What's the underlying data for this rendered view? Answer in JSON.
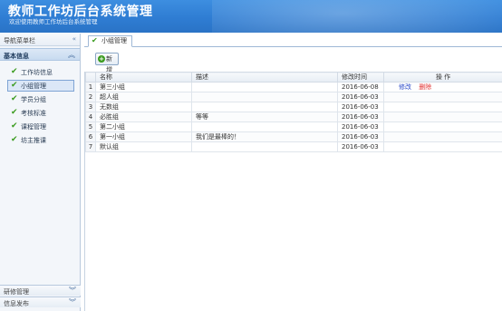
{
  "header": {
    "title": "教师工作坊后台系统管理",
    "subtitle": "欢迎使用教师工作坊后台系统管理"
  },
  "sidebar": {
    "nav_title": "导航菜单栏",
    "collapse_glyph": "«",
    "section_title": "基本信息",
    "section_glyph": "︽",
    "items": [
      {
        "label": "工作坊信息"
      },
      {
        "label": "小组管理"
      },
      {
        "label": "学员分组"
      },
      {
        "label": "考核标准"
      },
      {
        "label": "课程管理"
      },
      {
        "label": "坊主推课"
      }
    ],
    "accordion": [
      {
        "label": "研修管理",
        "glyph": "︾"
      },
      {
        "label": "信息发布",
        "glyph": "︾"
      }
    ]
  },
  "tab": {
    "label": "小组管理"
  },
  "toolbar": {
    "add_label": "新增",
    "add_icon": "+"
  },
  "table": {
    "columns": [
      "名称",
      "描述",
      "修改时间",
      "操 作"
    ],
    "rows": [
      {
        "idx": "1",
        "name": "第三小组",
        "desc": "",
        "time": "2016-06-08",
        "edit": "修改",
        "delete": "删除"
      },
      {
        "idx": "2",
        "name": "超人组",
        "desc": "",
        "time": "2016-06-03",
        "edit": "",
        "delete": ""
      },
      {
        "idx": "3",
        "name": "无数组",
        "desc": "",
        "time": "2016-06-03",
        "edit": "",
        "delete": ""
      },
      {
        "idx": "4",
        "name": "必胜组",
        "desc": "等等",
        "time": "2016-06-03",
        "edit": "",
        "delete": ""
      },
      {
        "idx": "5",
        "name": "第二小组",
        "desc": "",
        "time": "2016-06-03",
        "edit": "",
        "delete": ""
      },
      {
        "idx": "6",
        "name": "第一小组",
        "desc": "我们是最棒的！",
        "time": "2016-06-03",
        "edit": "",
        "delete": ""
      },
      {
        "idx": "7",
        "name": "默认组",
        "desc": "",
        "time": "2016-06-03",
        "edit": "",
        "delete": ""
      }
    ]
  },
  "colors": {
    "header": "#2f7dd3",
    "check": "#3a9b1e",
    "edit_link": "#2a49c8",
    "delete_link": "#e03030"
  }
}
